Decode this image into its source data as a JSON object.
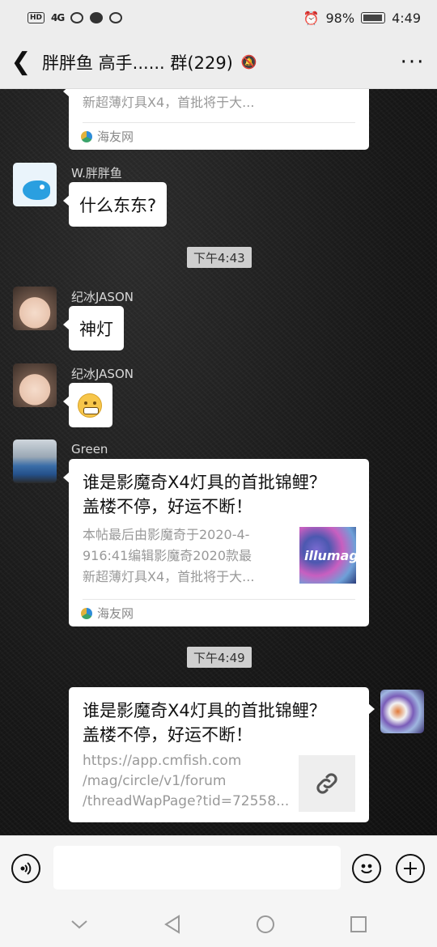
{
  "status_bar": {
    "left_labels": [
      "HD",
      "4G",
      "."
    ],
    "battery_percent": "98%",
    "time": "4:49"
  },
  "nav": {
    "title": "胖胖鱼 高手...... 群(229)",
    "more_label": "···"
  },
  "messages": {
    "card_top": {
      "desc_line": "新超薄灯具X4，首批将于大...",
      "source": "海友网"
    },
    "msg1": {
      "sender": "W.胖胖鱼",
      "text": "什么东东?"
    },
    "time1": "下午4:43",
    "msg2": {
      "sender": "纪冰JASON",
      "text": "神灯"
    },
    "msg3": {
      "sender": "纪冰JASON",
      "emoji": "grimacing-face"
    },
    "msg4": {
      "sender": "Green",
      "title_line1": "谁是影魔奇X4灯具的首批锦鲤？",
      "title_line2": "盖楼不停，好运不断！",
      "desc_line1": "本帖最后由影魔奇于2020-4-",
      "desc_line2": "916:41编辑影魔奇2020款最",
      "desc_line3": "新超薄灯具X4，首批将于大...",
      "thumb_text": "illumagi",
      "source": "海友网"
    },
    "time2": "下午4:49",
    "msg5": {
      "title_line1": "谁是影魔奇X4灯具的首批锦鲤？",
      "title_line2": "盖楼不停，好运不断！",
      "url_line1": "https://app.cmfish.com",
      "url_line2": "/mag/circle/v1/forum",
      "url_line3": "/threadWapPage?tid=72558..."
    }
  },
  "input_bar": {
    "voice_icon": "voice-icon",
    "emoji_icon": "emoji-icon",
    "plus_icon": "plus-icon",
    "placeholder": ""
  },
  "system_nav": {
    "icons": [
      "chevron-down-icon",
      "back-triangle-icon",
      "home-circle-icon",
      "recents-square-icon"
    ]
  }
}
